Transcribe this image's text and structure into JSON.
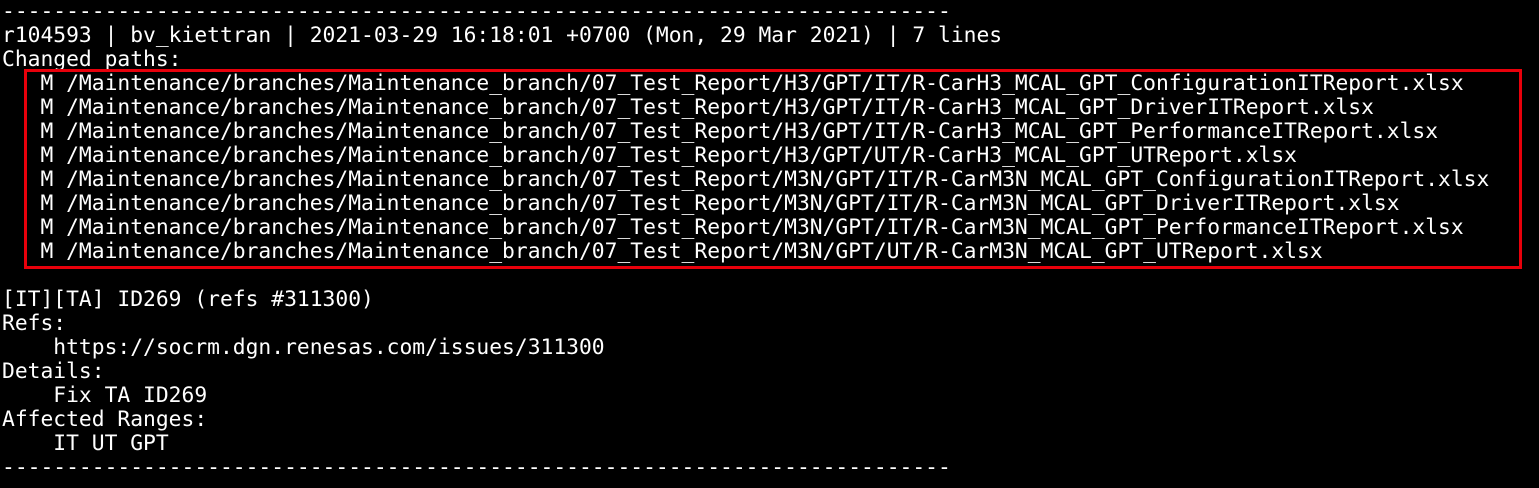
{
  "terminal": {
    "separator_top": "--------------------------------------------------------------------------",
    "revision_line": "r104593 | bv_kiettran | 2021-03-29 16:18:01 +0700 (Mon, 29 Mar 2021) | 7 lines",
    "changed_paths_label": "Changed paths:",
    "changed_paths": [
      "   M /Maintenance/branches/Maintenance_branch/07_Test_Report/H3/GPT/IT/R-CarH3_MCAL_GPT_ConfigurationITReport.xlsx",
      "   M /Maintenance/branches/Maintenance_branch/07_Test_Report/H3/GPT/IT/R-CarH3_MCAL_GPT_DriverITReport.xlsx",
      "   M /Maintenance/branches/Maintenance_branch/07_Test_Report/H3/GPT/IT/R-CarH3_MCAL_GPT_PerformanceITReport.xlsx",
      "   M /Maintenance/branches/Maintenance_branch/07_Test_Report/H3/GPT/UT/R-CarH3_MCAL_GPT_UTReport.xlsx",
      "   M /Maintenance/branches/Maintenance_branch/07_Test_Report/M3N/GPT/IT/R-CarM3N_MCAL_GPT_ConfigurationITReport.xlsx",
      "   M /Maintenance/branches/Maintenance_branch/07_Test_Report/M3N/GPT/IT/R-CarM3N_MCAL_GPT_DriverITReport.xlsx",
      "   M /Maintenance/branches/Maintenance_branch/07_Test_Report/M3N/GPT/IT/R-CarM3N_MCAL_GPT_PerformanceITReport.xlsx",
      "   M /Maintenance/branches/Maintenance_branch/07_Test_Report/M3N/GPT/UT/R-CarM3N_MCAL_GPT_UTReport.xlsx"
    ],
    "commit_title": "[IT][TA] ID269 (refs #311300)",
    "refs_label": "Refs:",
    "refs_url": "    https://socrm.dgn.renesas.com/issues/311300",
    "details_label": "Details:",
    "details_text": "    Fix TA ID269",
    "affected_label": "Affected Ranges:",
    "affected_text": "    IT UT GPT",
    "separator_bottom": "--------------------------------------------------------------------------"
  },
  "colors": {
    "background": "#000000",
    "text": "#ffffff",
    "highlight_border": "#e8000b"
  }
}
